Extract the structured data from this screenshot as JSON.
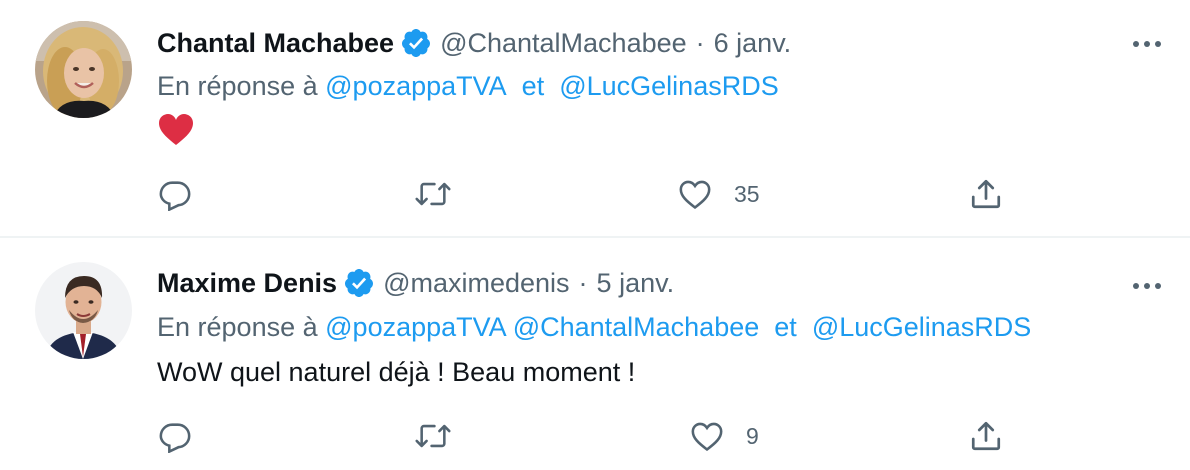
{
  "tweets": [
    {
      "author_name": "Chantal Machabee",
      "handle": "@ChantalMachabee",
      "separator": "·",
      "date": "6 janv.",
      "reply_prefix": "En réponse à",
      "mentions": [
        "@pozappaTVA",
        "@LucGelinasRDS"
      ],
      "mention_conjunction": "et",
      "content_emoji": "red-heart",
      "text": "",
      "actions": {
        "reply_count": "",
        "retweet_count": "",
        "like_count": "35"
      }
    },
    {
      "author_name": "Maxime Denis",
      "handle": "@maximedenis",
      "separator": "·",
      "date": "5 janv.",
      "reply_prefix": "En réponse à",
      "mentions": [
        "@pozappaTVA",
        "@ChantalMachabee",
        "@LucGelinasRDS"
      ],
      "mention_conjunction": "et",
      "text": "WoW quel naturel déjà ! Beau moment !",
      "actions": {
        "reply_count": "",
        "retweet_count": "",
        "like_count": "9"
      }
    }
  ],
  "icons": {
    "verified": "verified-badge-icon",
    "more": "more-options-icon",
    "reply": "reply-icon",
    "retweet": "retweet-icon",
    "like": "heart-icon",
    "share": "share-icon"
  },
  "colors": {
    "accent": "#1d9bf0",
    "secondary_text": "#536471",
    "primary_text": "#0f1419",
    "divider": "#eff3f4",
    "heart_emoji": "#dd2e44"
  }
}
